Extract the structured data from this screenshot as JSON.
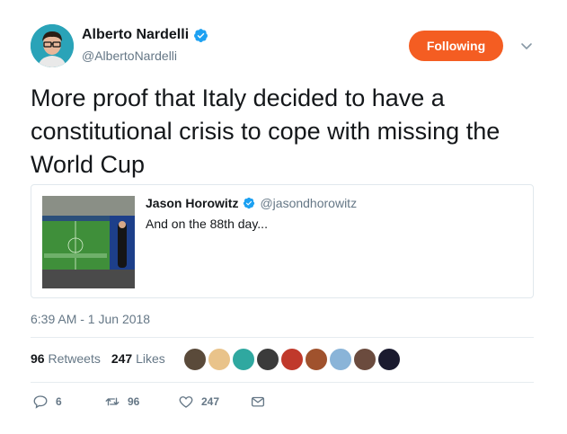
{
  "author": {
    "name": "Alberto Nardelli",
    "handle": "@AlbertoNardelli",
    "verified": true
  },
  "follow_button": {
    "label": "Following",
    "color": "#f45d22"
  },
  "tweet": {
    "text": "More proof that Italy decided to have a constitutional crisis to cope with missing the World Cup",
    "timestamp": "6:39 AM - 1 Jun 2018"
  },
  "quoted_tweet": {
    "name": "Jason Horowitz",
    "handle": "@jasondhorowitz",
    "text": "And on the 88th day..."
  },
  "stats": {
    "retweets_count": "96",
    "retweets_label": "Retweets",
    "likes_count": "247",
    "likes_label": "Likes"
  },
  "likers": [
    "#5a4a3a",
    "#e9c38a",
    "#2fa8a0",
    "#3b3b3b",
    "#c0392b",
    "#a0522d",
    "#8ab4d8",
    "#6b4b3e",
    "#1b1b2f"
  ],
  "actions": {
    "reply_count": "6",
    "retweet_count": "96",
    "like_count": "247"
  },
  "colors": {
    "accent": "#f45d22",
    "verified": "#1da1f2",
    "muted": "#657786"
  }
}
